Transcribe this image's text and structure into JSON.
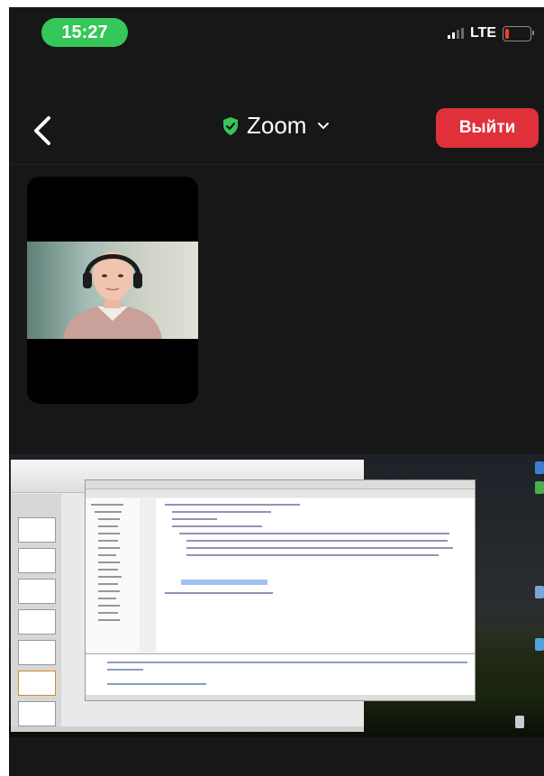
{
  "status_bar": {
    "time": "15:27",
    "network": "LTE",
    "icons": [
      "signal-bars-icon",
      "battery-low-icon"
    ],
    "battery_level_percent": 15,
    "colors": {
      "time_pill": "#35c759",
      "battery": "#ff3b30"
    }
  },
  "header": {
    "back_icon": "chevron-left-icon",
    "meeting_app": "Zoom",
    "security_icon": "shield-check-icon",
    "dropdown_icon": "chevron-down-icon",
    "leave_button": "Выйти",
    "colors": {
      "leave_button": "#e0313a",
      "shield": "#35c759"
    }
  },
  "participant_video": {
    "description_icon": "participant-video"
  },
  "screen_share": {
    "windows": [
      "presentation-app-window",
      "python-ide-window"
    ]
  }
}
